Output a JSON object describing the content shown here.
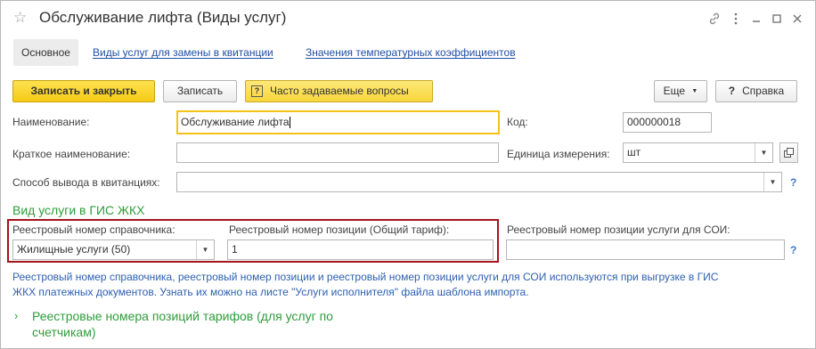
{
  "window": {
    "title": "Обслуживание лифта (Виды услуг)",
    "star_icon": "star-icon",
    "controls": [
      "link-icon",
      "more-icon",
      "minimize-icon",
      "maximize-icon",
      "close-icon"
    ]
  },
  "tabs": [
    {
      "label": "Основное",
      "active": true
    },
    {
      "label": "Виды услуг для замены в квитанции",
      "active": false
    },
    {
      "label": "Значения температурных коэффициентов",
      "active": false
    }
  ],
  "toolbar": {
    "save_close": "Записать и закрыть",
    "save": "Записать",
    "faq": "Часто задаваемые вопросы",
    "more": "Еще",
    "help": "Справка"
  },
  "form": {
    "name_label": "Наименование:",
    "name_value": "Обслуживание лифта",
    "code_label": "Код:",
    "code_value": "000000018",
    "short_name_label": "Краткое наименование:",
    "short_name_value": "",
    "unit_label": "Единица измерения:",
    "unit_value": "шт",
    "output_label": "Способ вывода в квитанциях:",
    "output_value": "",
    "help_mark": "?"
  },
  "gis": {
    "section_title": "Вид услуги в ГИС ЖКХ",
    "directory_label": "Реестровый номер справочника:",
    "directory_value": "Жилищные услуги (50)",
    "position_label": "Реестровый номер позиции (Общий тариф):",
    "position_value": "1",
    "soi_label": "Реестровый номер позиции услуги для СОИ:",
    "soi_value": "",
    "note_line1": "Реестровый номер справочника, реестровый номер позиции и реестровый номер позиции услуги для СОИ используются при выгрузке в ГИС",
    "note_line2": "ЖКХ платежных документов. Узнать их можно на листе \"Услуги исполнителя\" файла шаблона импорта.",
    "tariffs_line1": "Реестровые номера позиций тарифов (для услуг по",
    "tariffs_line2": "счетчикам)"
  },
  "colors": {
    "accent_yellow": "#f6cb14",
    "link_blue": "#1f4fa6",
    "section_green": "#2e9d3a",
    "highlight_red": "#a4141b"
  }
}
